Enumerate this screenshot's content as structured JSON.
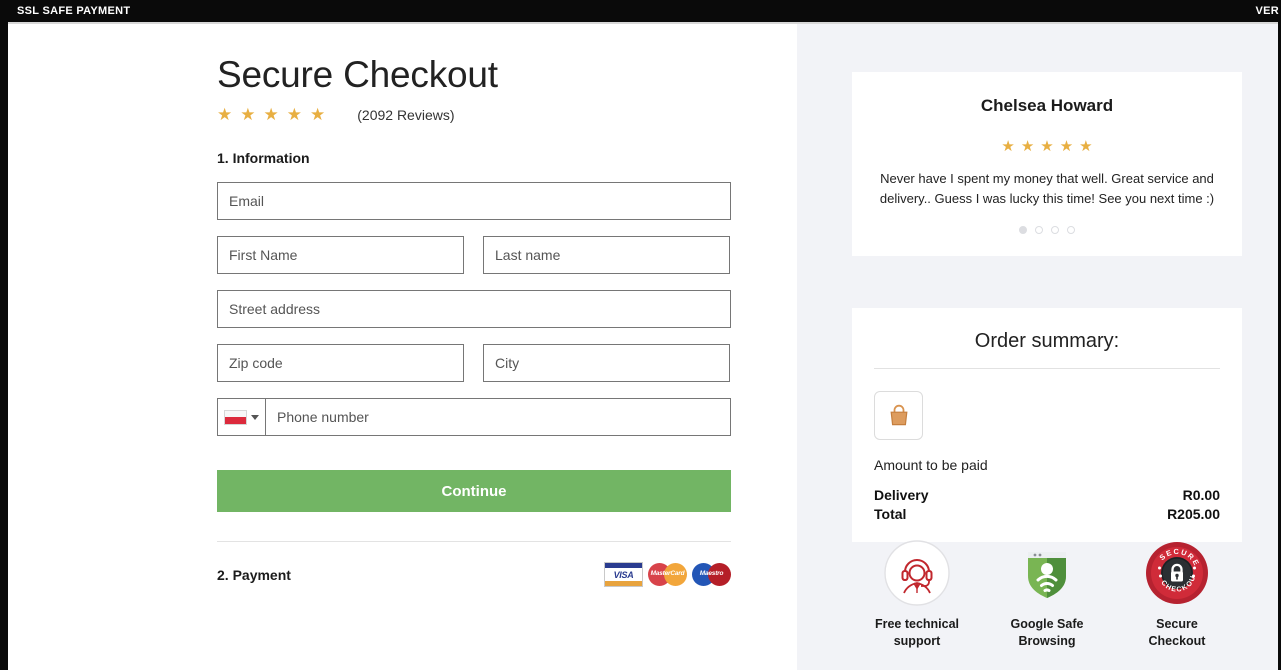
{
  "topbar": {
    "left_label": "SSL SAFE PAYMENT",
    "right_label": "VER"
  },
  "checkout": {
    "title": "Secure Checkout",
    "stars": [
      "★",
      "★",
      "★",
      "★",
      "★"
    ],
    "review_count": "(2092 Reviews)",
    "star_color": "#e8af42",
    "section_information": "1. Information",
    "fields": {
      "email_placeholder": "Email",
      "first_name_placeholder": "First Name",
      "last_name_placeholder": "Last name",
      "street_placeholder": "Street address",
      "zip_placeholder": "Zip code",
      "city_placeholder": "City",
      "phone_placeholder": "Phone number",
      "country_flag": "poland-flag"
    },
    "continue_label": "Continue",
    "section_payment": "2. Payment",
    "card_logos": [
      {
        "name": "visa",
        "label": "VISA"
      },
      {
        "name": "mastercard",
        "label": "MasterCard"
      },
      {
        "name": "maestro",
        "label": "Maestro"
      }
    ],
    "continue_button_color": "#72b564"
  },
  "testimonial": {
    "name": "Chelsea Howard",
    "stars": [
      "★",
      "★",
      "★",
      "★",
      "★"
    ],
    "text": "Never have I spent my money that well. Great service and delivery.. Guess I was lucky this time! See you next time :)",
    "dots": [
      true,
      false,
      false,
      false
    ]
  },
  "order_summary": {
    "title": "Order summary:",
    "item_icon": "shopping-bag-icon",
    "amount_label": "Amount to be paid",
    "lines": [
      {
        "label": "Delivery",
        "value": "R0.00"
      },
      {
        "label": "Total",
        "value": "R205.00"
      }
    ]
  },
  "trust_badges": [
    {
      "icon": "headset-support-icon",
      "line1": "Free technical",
      "line2": "support"
    },
    {
      "icon": "google-safe-browsing-shield-icon",
      "line1": "Google Safe",
      "line2": "Browsing"
    },
    {
      "icon": "secure-checkout-seal-icon",
      "line1": "Secure",
      "line2": "Checkout"
    }
  ]
}
